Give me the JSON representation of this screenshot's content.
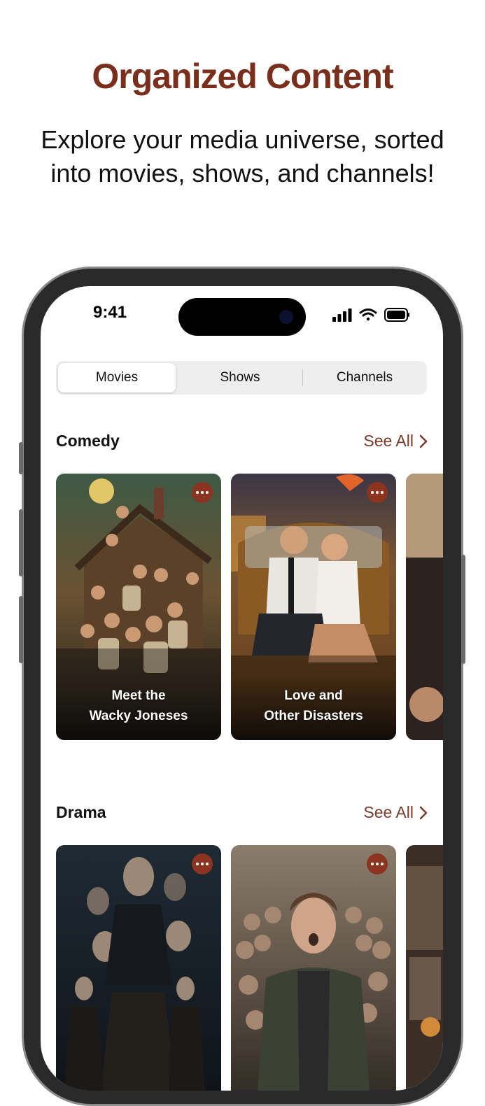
{
  "headline": "Organized Content",
  "subline": "Explore your media universe, sorted into movies, shows, and channels!",
  "status": {
    "time": "9:41",
    "icons": [
      "cellular-icon",
      "wifi-icon",
      "battery-icon"
    ]
  },
  "tabs": [
    {
      "label": "Movies",
      "active": true
    },
    {
      "label": "Shows",
      "active": false
    },
    {
      "label": "Channels",
      "active": false
    }
  ],
  "sections": [
    {
      "title": "Comedy",
      "see_all": "See All",
      "cards": [
        {
          "title": "Meet the\nWacky Joneses"
        },
        {
          "title": "Love and\nOther Disasters"
        },
        {
          "title": ""
        }
      ]
    },
    {
      "title": "Drama",
      "see_all": "See All",
      "cards": [
        {
          "title": ""
        },
        {
          "title": ""
        },
        {
          "title": ""
        }
      ]
    }
  ],
  "colors": {
    "accent": "#7a2e1c",
    "more_button": "#8b3420",
    "link": "#7a3a28"
  }
}
